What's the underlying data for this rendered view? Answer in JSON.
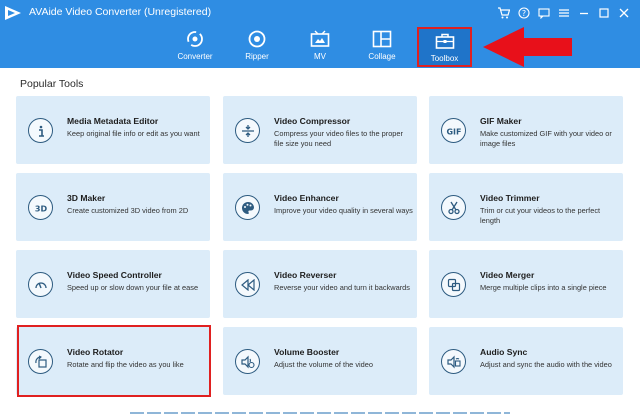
{
  "window": {
    "title": "AVAide Video Converter (Unregistered)"
  },
  "nav": {
    "tabs": [
      {
        "label": "Converter",
        "icon": "converter-icon"
      },
      {
        "label": "Ripper",
        "icon": "ripper-icon"
      },
      {
        "label": "MV",
        "icon": "mv-icon"
      },
      {
        "label": "Collage",
        "icon": "collage-icon"
      },
      {
        "label": "Toolbox",
        "icon": "toolbox-icon",
        "active": true
      }
    ]
  },
  "colors": {
    "header": "#2f8de3",
    "card": "#dcecf9",
    "highlight": "#e02020"
  },
  "section_title": "Popular Tools",
  "tools": [
    {
      "name": "Media Metadata Editor",
      "desc": "Keep original file info or edit as you want",
      "icon": "info-icon"
    },
    {
      "name": "Video Compressor",
      "desc": "Compress your video files to the proper file size you need",
      "icon": "compress-icon"
    },
    {
      "name": "GIF Maker",
      "desc": "Make customized GIF with your video or image files",
      "icon": "gif-icon"
    },
    {
      "name": "3D Maker",
      "desc": "Create customized 3D video from 2D",
      "icon": "3d-icon"
    },
    {
      "name": "Video Enhancer",
      "desc": "Improve your video quality in several ways",
      "icon": "palette-icon"
    },
    {
      "name": "Video Trimmer",
      "desc": "Trim or cut your videos to the perfect length",
      "icon": "scissors-icon"
    },
    {
      "name": "Video Speed Controller",
      "desc": "Speed up or slow down your file at ease",
      "icon": "speedometer-icon"
    },
    {
      "name": "Video Reverser",
      "desc": "Reverse your video and turn it backwards",
      "icon": "rewind-icon"
    },
    {
      "name": "Video Merger",
      "desc": "Merge multiple clips into a single piece",
      "icon": "merge-icon"
    },
    {
      "name": "Video Rotator",
      "desc": "Rotate and flip the video as you like",
      "icon": "rotate-icon"
    },
    {
      "name": "Volume Booster",
      "desc": "Adjust the volume of the video",
      "icon": "volume-icon"
    },
    {
      "name": "Audio Sync",
      "desc": "Adjust and sync the audio with the video",
      "icon": "audio-sync-icon"
    }
  ]
}
